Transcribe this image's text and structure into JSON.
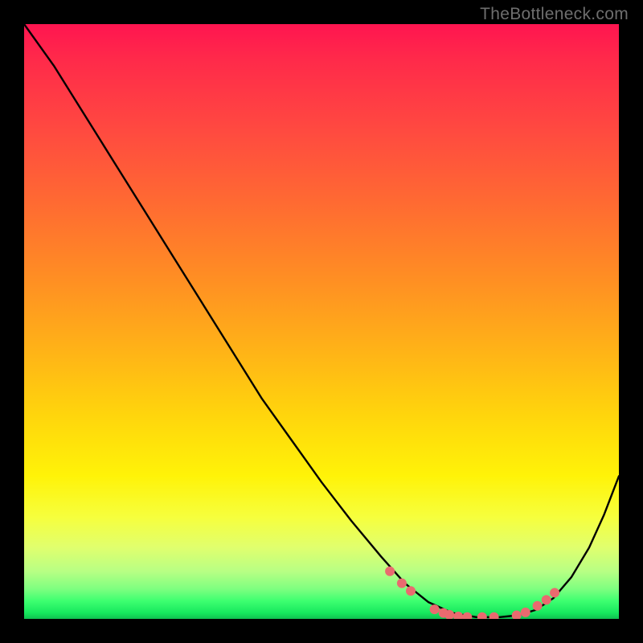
{
  "watermark": "TheBottleneck.com",
  "colors": {
    "background": "#000000",
    "curve": "#000000",
    "marker": "#e96a6f",
    "gradient_top": "#ff1550",
    "gradient_bottom": "#10c050"
  },
  "chart_data": {
    "type": "line",
    "title": "",
    "xlabel": "",
    "ylabel": "",
    "x_range_fraction": [
      0.0,
      1.0
    ],
    "y_range_fraction": [
      0.0,
      1.0
    ],
    "series": [
      {
        "name": "bottleneck-curve",
        "x": [
          0.0,
          0.05,
          0.1,
          0.15,
          0.2,
          0.25,
          0.3,
          0.35,
          0.4,
          0.45,
          0.5,
          0.55,
          0.6,
          0.64,
          0.68,
          0.72,
          0.76,
          0.8,
          0.83,
          0.86,
          0.89,
          0.92,
          0.95,
          0.975,
          1.0
        ],
        "y": [
          1.0,
          0.93,
          0.85,
          0.77,
          0.69,
          0.61,
          0.53,
          0.45,
          0.37,
          0.3,
          0.23,
          0.165,
          0.105,
          0.06,
          0.028,
          0.01,
          0.003,
          0.003,
          0.006,
          0.015,
          0.035,
          0.07,
          0.12,
          0.175,
          0.24
        ]
      }
    ],
    "markers": {
      "name": "highlight-points",
      "x": [
        0.615,
        0.635,
        0.65,
        0.69,
        0.705,
        0.715,
        0.73,
        0.745,
        0.77,
        0.79,
        0.828,
        0.843,
        0.863,
        0.878,
        0.892
      ],
      "y": [
        0.08,
        0.06,
        0.047,
        0.016,
        0.01,
        0.007,
        0.004,
        0.003,
        0.003,
        0.003,
        0.006,
        0.011,
        0.022,
        0.032,
        0.044
      ]
    }
  }
}
